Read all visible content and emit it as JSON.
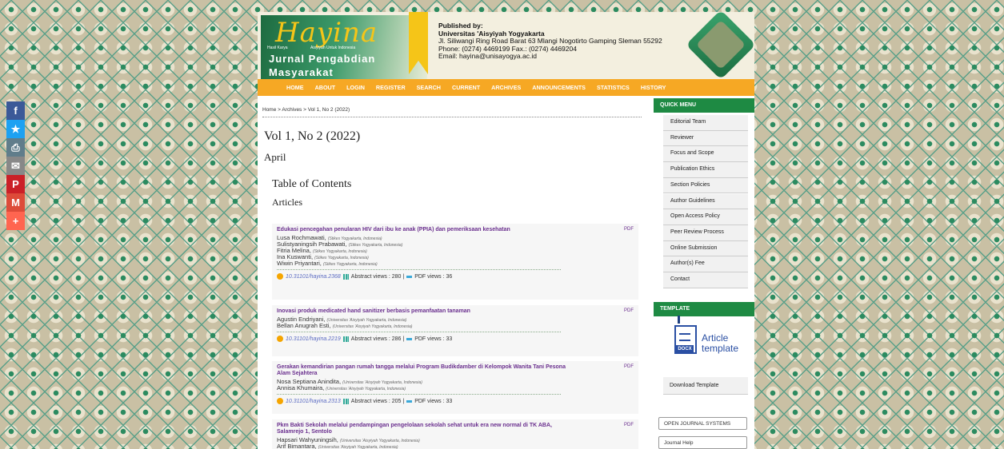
{
  "share": {
    "items": [
      {
        "name": "facebook-icon",
        "glyph": "f",
        "color": "#3b5998"
      },
      {
        "name": "twitter-icon",
        "glyph": "★",
        "color": "#1da1f2"
      },
      {
        "name": "print-icon",
        "glyph": "⎙",
        "color": "#607d8b"
      },
      {
        "name": "email-icon",
        "glyph": "✉",
        "color": "#888888"
      },
      {
        "name": "pinterest-icon",
        "glyph": "P",
        "color": "#cb2027"
      },
      {
        "name": "gmail-icon",
        "glyph": "M",
        "color": "#dd4b39"
      },
      {
        "name": "more-share-icon",
        "glyph": "+",
        "color": "#ff6550"
      }
    ]
  },
  "header": {
    "logo_script": "Hayina",
    "logo_tag1": "Hasil Karya",
    "logo_tag2": "Aisyiyah Untuk Indonesia",
    "logo_title1": "Jurnal Pengabdian",
    "logo_title2": "Masyarakat",
    "pub_label": "Published by:",
    "pub_name": "Universitas 'Aisyiyah Yogyakarta",
    "pub_address": "Jl. Siliwangi Ring Road Barat 63 Mlangi Nogotirto Gamping Sleman 55292",
    "pub_phone": "Phone: (0274) 4469199 Fax.: (0274) 4469204",
    "pub_email": "Email: hayina@unisayogya.ac.id"
  },
  "nav": [
    "HOME",
    "ABOUT",
    "LOGIN",
    "REGISTER",
    "SEARCH",
    "CURRENT",
    "ARCHIVES",
    "ANNOUNCEMENTS",
    "STATISTICS",
    "HISTORY"
  ],
  "main": {
    "breadcrumb": "Home > Archives > Vol 1, No 2 (2022)",
    "issue_title": "Vol 1, No 2 (2022)",
    "issue_month": "April",
    "toc_heading": "Table of Contents",
    "section_heading": "Articles"
  },
  "articles": [
    {
      "title": "Edukasi pencegahan penularan HIV dari ibu ke anak (PPIA) dan pemeriksaan kesehatan",
      "pdf": "PDF",
      "authors": [
        {
          "name": "Lusa Rochmawati,",
          "aff": "(Stikes Yogyakarta, Indonesia)"
        },
        {
          "name": "Sulistyaningsih Prabawati,",
          "aff": "(Stikes Yogyakarta, Indonesia)"
        },
        {
          "name": "Fitria Melina,",
          "aff": "(Stikes Yogyakarta, Indonesia)"
        },
        {
          "name": "Ina Kuswanti,",
          "aff": "(Stikes Yogyakarta, Indonesia)"
        },
        {
          "name": "Wiwin Priyantari,",
          "aff": "(Stikes Yogyakarta, Indonesia)"
        }
      ],
      "doi": "10.31101/hayina.2368",
      "abstract_views": "Abstract views : 280",
      "pdf_views": "PDF views : 36"
    },
    {
      "title": "Inovasi produk medicated hand sanitizer berbasis pemanfaatan tanaman",
      "pdf": "PDF",
      "authors": [
        {
          "name": "Agustin Endriyani,",
          "aff": "(Universitas 'Aisyiyah Yogyakarta, Indonesia)"
        },
        {
          "name": "Bellan Anugrah Esti,",
          "aff": "(Universitas 'Aisyiyah Yogyakarta, Indonesia)"
        }
      ],
      "doi": "10.31101/hayina.2219",
      "abstract_views": "Abstract views : 286",
      "pdf_views": "PDF views : 33"
    },
    {
      "title": "Gerakan kemandirian pangan rumah tangga melalui Program Budikdamber di Kelompok Wanita Tani Pesona Alam Sejahtera",
      "pdf": "PDF",
      "authors": [
        {
          "name": "Nosa Septiana Anindita,",
          "aff": "(Universitas 'Aisyiyah Yogyakarta, Indonesia)"
        },
        {
          "name": "Annisa Khumaira,",
          "aff": "(Universitas 'Aisyiyah Yogyakarta, Indonesia)"
        }
      ],
      "doi": "10.31101/hayina.2313",
      "abstract_views": "Abstract views : 205",
      "pdf_views": "PDF views : 33"
    },
    {
      "title": "Pkm Bakti Sekolah melalui pendampingan pengelolaan sekolah sehat untuk era new normal di TK ABA, Salamrejo 1, Sentolo",
      "pdf": "PDF",
      "authors": [
        {
          "name": "Hapsari Wahyuningsih,",
          "aff": "(Universitas 'Aisyiyah Yogyakarta, Indonesia)"
        },
        {
          "name": "Arif Bimantara,",
          "aff": "(Universitas 'Aisyiyah Yogyakarta, Indonesia)"
        }
      ],
      "doi": "",
      "abstract_views": "",
      "pdf_views": ""
    }
  ],
  "sidebar": {
    "quick_menu_title": "QUICK MENU",
    "quick_menu": [
      "Editorial Team",
      "Reviewer",
      "Focus and Scope",
      "Publication Ethics",
      "Section Policies",
      "Author Guidelines",
      "Open Access Policy",
      "Peer Review Process",
      "Online Submission",
      "Author(s) Fee",
      "Contact"
    ],
    "template_title": "TEMPLATE",
    "template_docx": "DOCX",
    "template_text1": "Article",
    "template_text2": "template",
    "download_template": "Download Template",
    "ojs_button": "OPEN JOURNAL SYSTEMS",
    "journal_help": "Journal Help"
  },
  "colors": {
    "nav": "#f6a824",
    "sidebar_header": "#1e8a43",
    "article_title": "#6a2f8e"
  }
}
